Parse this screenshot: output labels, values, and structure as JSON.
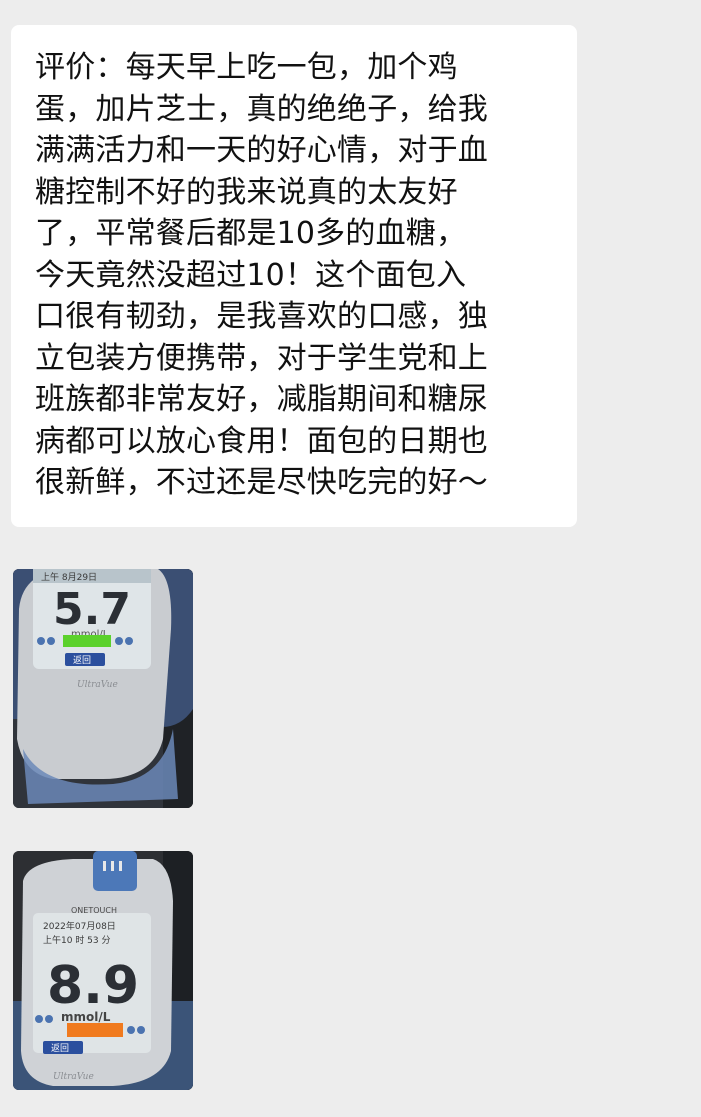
{
  "message": {
    "text": "评价：每天早上吃一包，加个鸡\n蛋，加片芝士，真的绝绝子，给我\n满满活力和一天的好心情，对于血\n糖控制不好的我来说真的太友好\n了，平常餐后都是10多的血糖，\n今天竟然没超过10！这个面包入\n口很有韧劲，是我喜欢的口感，独\n立包装方便携带，对于学生党和上\n班族都非常友好，减脂期间和糖尿\n病都可以放心食用！面包的日期也\n很新鲜，不过还是尽快吃完的好～"
  },
  "images": [
    {
      "reading": "5.7",
      "unit": "mmol/L",
      "date_line": "上午 8月29日",
      "button": "返回",
      "brand": "UltraVue",
      "indicator_color": "#5bd12c"
    },
    {
      "reading": "8.9",
      "unit": "mmol/L",
      "date_line": "2022年07月08日",
      "time_line": "上午10 时 53 分",
      "header": "ONETOUCH",
      "button": "返回",
      "brand": "UltraVue",
      "indicator_color": "#f07a1e"
    }
  ]
}
